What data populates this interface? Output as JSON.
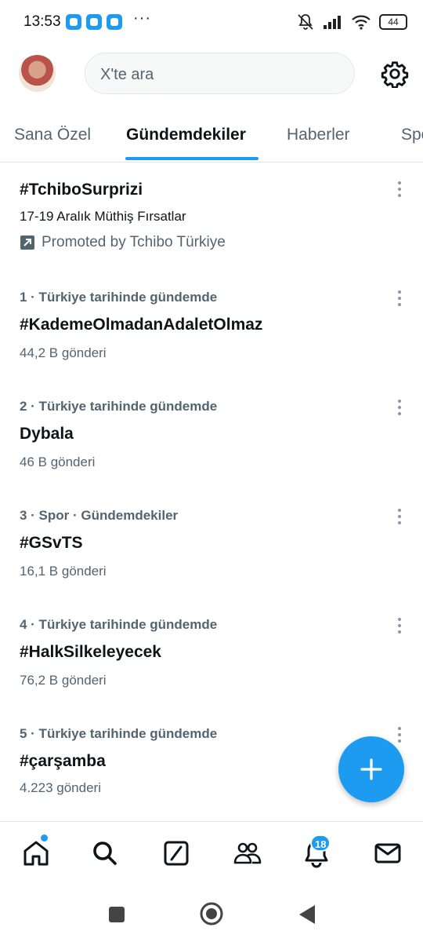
{
  "status_bar": {
    "time": "13:53",
    "more": "···",
    "battery": "44"
  },
  "header": {
    "search_placeholder": "X'te ara"
  },
  "tabs": [
    {
      "label": "Sana Özel"
    },
    {
      "label": "Gündemdekiler"
    },
    {
      "label": "Haberler"
    },
    {
      "label": "Spor"
    }
  ],
  "promoted": {
    "title": "#TchiboSurprizi",
    "subtitle": "17-19 Aralık Müthiş Fırsatlar",
    "promoted_by": "Promoted by Tchibo Türkiye"
  },
  "trends": [
    {
      "meta": "1 · Türkiye tarihinde gündemde",
      "title": "#KademeOlmadanAdaletOlmaz",
      "count": "44,2 B gönderi"
    },
    {
      "meta": "2 · Türkiye tarihinde gündemde",
      "title": "Dybala",
      "count": "46 B gönderi"
    },
    {
      "meta": "3 · Spor · Gündemdekiler",
      "title": "#GSvTS",
      "count": "16,1 B gönderi"
    },
    {
      "meta": "4 · Türkiye tarihinde gündemde",
      "title": "#HalkSilkeleyecek",
      "count": "76,2 B gönderi"
    },
    {
      "meta": "5 · Türkiye tarihinde gündemde",
      "title": "#çarşamba",
      "count": "4.223 gönderi"
    }
  ],
  "bottom_nav": {
    "notifications_badge": "18",
    "items": [
      "home-icon",
      "search-icon",
      "grok-icon",
      "communities-icon",
      "notifications-icon",
      "messages-icon"
    ]
  },
  "colors": {
    "accent": "#1d9bf0",
    "secondary_text": "#536471",
    "primary_text": "#0f1419"
  }
}
